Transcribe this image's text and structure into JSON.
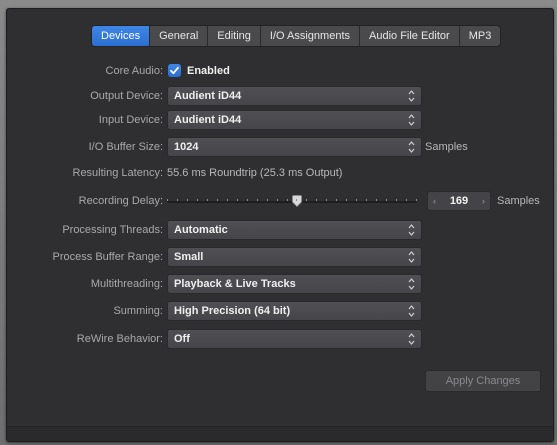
{
  "tabs": [
    {
      "label": "Devices",
      "active": true
    },
    {
      "label": "General",
      "active": false
    },
    {
      "label": "Editing",
      "active": false
    },
    {
      "label": "I/O Assignments",
      "active": false
    },
    {
      "label": "Audio File Editor",
      "active": false
    },
    {
      "label": "MP3",
      "active": false
    }
  ],
  "core_audio": {
    "label": "Core Audio:",
    "checkbox_label": "Enabled",
    "checked": true
  },
  "output_device": {
    "label": "Output Device:",
    "value": "Audient iD44"
  },
  "input_device": {
    "label": "Input Device:",
    "value": "Audient iD44"
  },
  "io_buffer": {
    "label": "I/O Buffer Size:",
    "value": "1024",
    "unit": "Samples"
  },
  "latency": {
    "label": "Resulting Latency:",
    "value": "55.6 ms Roundtrip (25.3 ms Output)"
  },
  "recording_delay": {
    "label": "Recording Delay:",
    "value": "169",
    "unit": "Samples",
    "slider_fraction": 0.52
  },
  "processing_threads": {
    "label": "Processing Threads:",
    "value": "Automatic"
  },
  "buffer_range": {
    "label": "Process Buffer Range:",
    "value": "Small"
  },
  "multithreading": {
    "label": "Multithreading:",
    "value": "Playback & Live Tracks"
  },
  "summing": {
    "label": "Summing:",
    "value": "High Precision (64 bit)"
  },
  "rewire": {
    "label": "ReWire Behavior:",
    "value": "Off"
  },
  "apply_button": {
    "label": "Apply Changes"
  },
  "colors": {
    "accent": "#2f77dc",
    "panel": "#2f2f31",
    "control": "#4a4a4e"
  }
}
